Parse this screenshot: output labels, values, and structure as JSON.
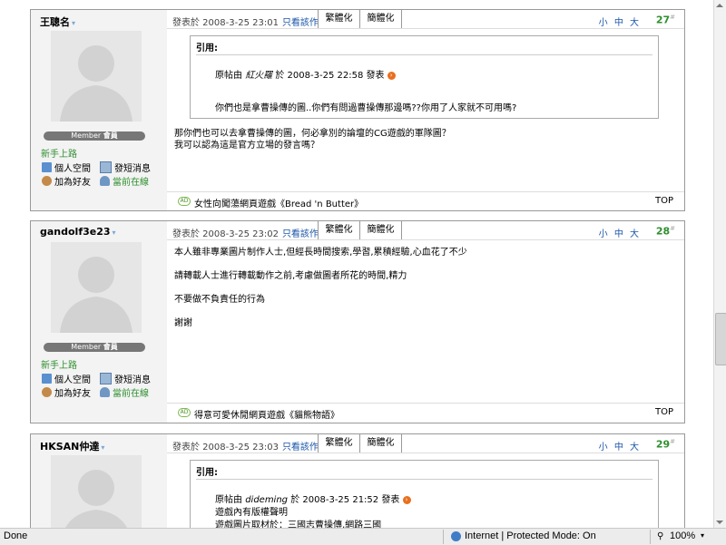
{
  "posts": [
    {
      "author": "王聰名",
      "rank_label": "Member",
      "rank_name": "會員",
      "level": "新手上路",
      "links": {
        "space": "個人空間",
        "pm": "發短消息",
        "friend": "加為好友",
        "online": "當前在線"
      },
      "time": "發表於 2008-3-25 23:01",
      "only_author": "只看該作者",
      "trad": "繁體化",
      "simp": "簡體化",
      "size": "小 中 大",
      "floor": "27",
      "quote": {
        "label": "引用:",
        "prefix": "原帖由",
        "quoted_user": "紅火羅",
        "suffix": "於 2008-3-25 22:58 發表",
        "text": "你們也是拿曹操傳的圖..你們有問過曹操傳那邊嗎??你用了人家就不可用嗎?"
      },
      "body": [
        "那你們也可以去拿曹操傳的圖，何必拿別的論壇的CG遊戲的軍隊圖？",
        "我可以認為這是官方立場的發言嗎？"
      ],
      "ad_text": "女性向闖蕩網頁遊戲《Bread 'n Butter》",
      "top": "TOP"
    },
    {
      "author": "gandolf3e23",
      "rank_label": "Member",
      "rank_name": "會員",
      "level": "新手上路",
      "links": {
        "space": "個人空間",
        "pm": "發短消息",
        "friend": "加為好友",
        "online": "當前在線"
      },
      "time": "發表於 2008-3-25 23:02",
      "only_author": "只看該作者",
      "trad": "繁體化",
      "simp": "簡體化",
      "size": "小 中 大",
      "floor": "28",
      "body": [
        "本人雖非專業圖片制作人士,但經長時間搜索,學習,累積經驗,心血花了不少",
        "",
        "請轉載人士進行轉載動作之前,考慮做圖者所花的時間,精力",
        "",
        "不要做不負責任的行為",
        "",
        "謝謝"
      ],
      "ad_text": "得意可愛休閒網頁遊戲《貓熊物語》",
      "top": "TOP"
    },
    {
      "author": "HKSAN仲達",
      "time": "發表於 2008-3-25 23:03",
      "only_author": "只看該作者",
      "trad": "繁體化",
      "simp": "簡體化",
      "size": "小 中 大",
      "floor": "29",
      "quote": {
        "label": "引用:",
        "prefix": "原帖由",
        "quoted_user": "dideming",
        "suffix": "於 2008-3-25 21:52 發表",
        "line1": "遊戲內有版權聲明",
        "line2": "遊戲圖片取材於：三國志曹操傳,網路三國"
      }
    }
  ],
  "status": {
    "left": "Done",
    "zone": "Internet | Protected Mode: On",
    "zoom": "100%"
  }
}
